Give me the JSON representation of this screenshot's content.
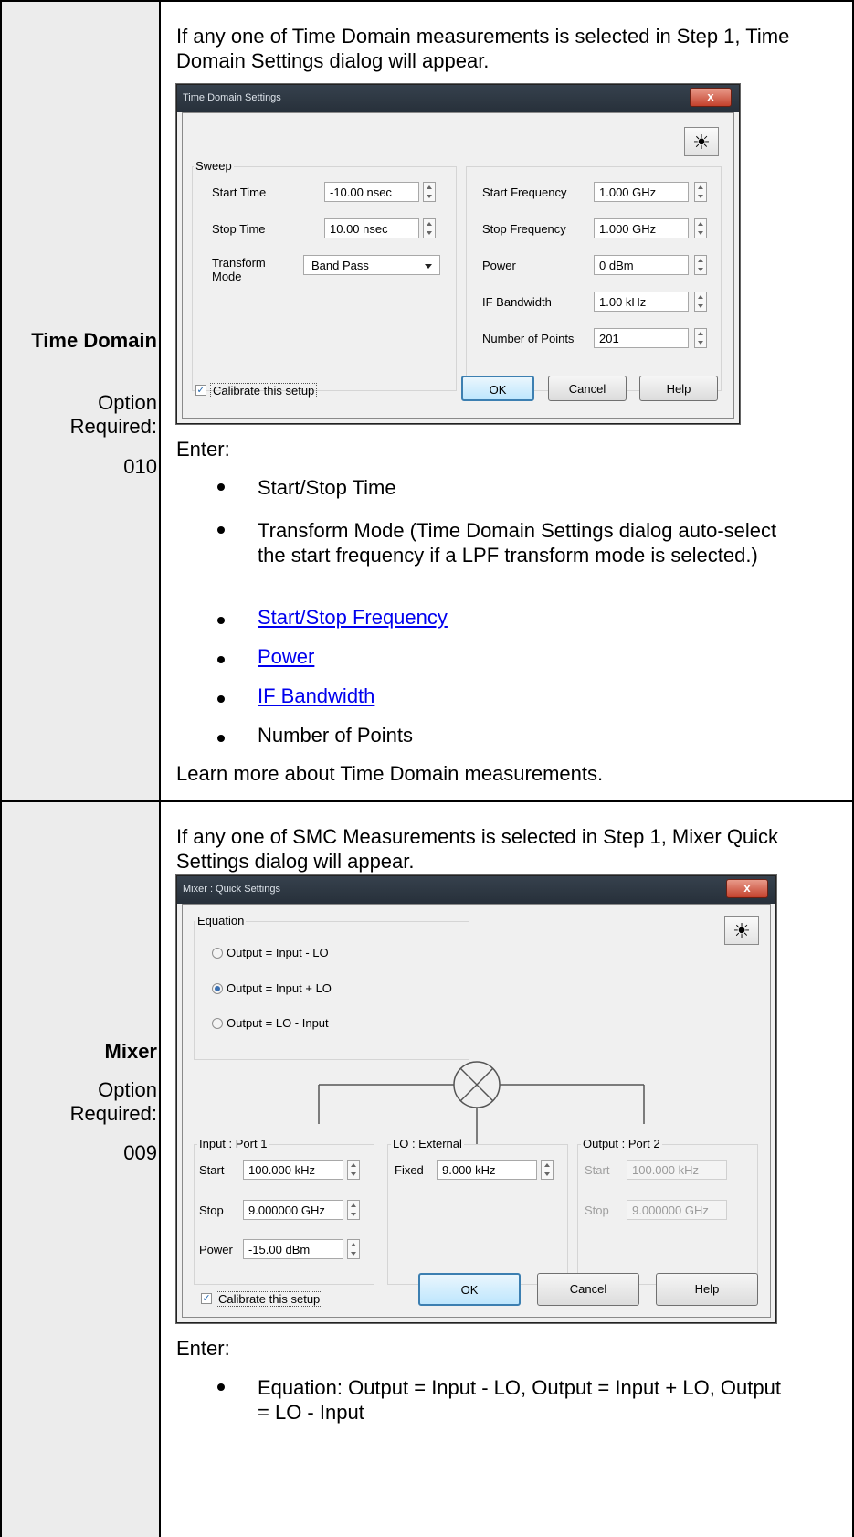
{
  "time_domain": {
    "label_title": "Time Domain",
    "label_option": "Option Required:",
    "label_code": "010",
    "intro": "If any one of Time Domain measurements is selected in Step 1, Time Domain Settings dialog will appear.",
    "enter": "Enter:",
    "bullets": [
      "Start/Stop Time",
      "Transform Mode (Time Domain Settings dialog auto-select the start frequency if a LPF transform mode is selected.)",
      "Start/Stop Frequency",
      "Power",
      "IF Bandwidth",
      "Number of Points"
    ],
    "learn_more": "Learn more about Time Domain measurements.",
    "dialog": {
      "title": "Time Domain Settings",
      "close": "x",
      "sweep_group": "Sweep",
      "start_time_label": "Start Time",
      "start_time": "-10.00 nsec",
      "stop_time_label": "Stop Time",
      "stop_time": "10.00 nsec",
      "transform_label": "Transform Mode",
      "transform_value": "Band Pass",
      "start_freq_label": "Start Frequency",
      "start_freq": "1.000 GHz",
      "stop_freq_label": "Stop Frequency",
      "stop_freq": "1.000 GHz",
      "power_label": "Power",
      "power": "0 dBm",
      "ifbw_label": "IF Bandwidth",
      "ifbw": "1.00 kHz",
      "points_label": "Number of Points",
      "points": "201",
      "calibrate": "Calibrate this setup",
      "ok": "OK",
      "cancel": "Cancel",
      "help": "Help",
      "sun_icon": "☀"
    }
  },
  "mixer": {
    "label_title": "Mixer",
    "label_option": "Option Required:",
    "label_code": "009",
    "intro": "If any one of SMC Measurements is selected in Step 1, Mixer Quick Settings dialog will appear.",
    "enter": "Enter:",
    "bullets": [
      "Equation: Output = Input - LO, Output = Input + LO, Output = LO - Input"
    ],
    "dialog": {
      "title": "Mixer : Quick Settings",
      "close": "x",
      "equation_group": "Equation",
      "eq1": "Output = Input  -  LO",
      "eq2": "Output = Input  +  LO",
      "eq3": "Output =  LO  -  Input",
      "input_group": "Input : Port 1",
      "in_start_label": "Start",
      "in_start": "100.000 kHz",
      "in_stop_label": "Stop",
      "in_stop": "9.000000 GHz",
      "in_power_label": "Power",
      "in_power": "-15.00 dBm",
      "lo_group": "LO : External",
      "lo_fixed_label": "Fixed",
      "lo_fixed": "9.000 kHz",
      "out_group": "Output : Port 2",
      "out_start_label": "Start",
      "out_start": "100.000 kHz",
      "out_stop_label": "Stop",
      "out_stop": "9.000000 GHz",
      "calibrate": "Calibrate this setup",
      "ok": "OK",
      "cancel": "Cancel",
      "help": "Help",
      "sun_icon": "☀"
    }
  }
}
